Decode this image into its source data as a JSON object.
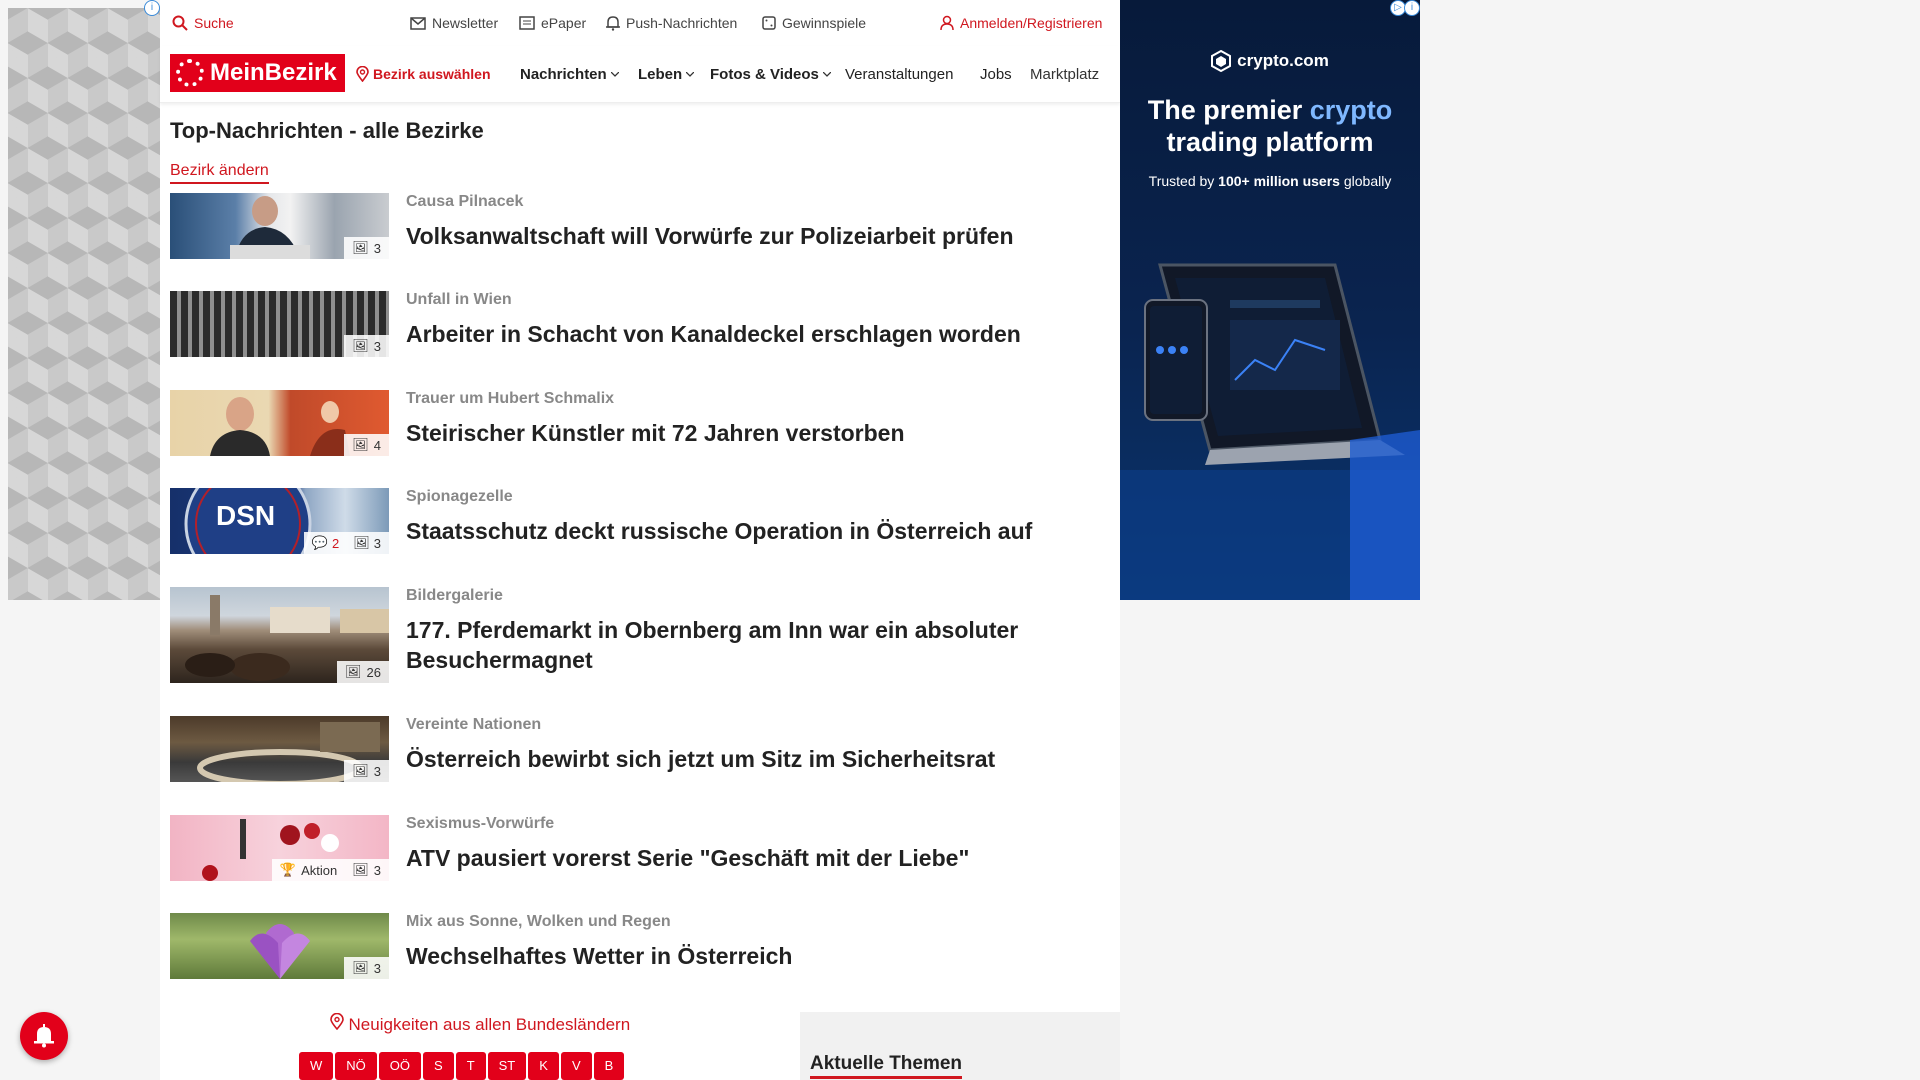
{
  "topbar": {
    "search": "Suche",
    "newsletter": "Newsletter",
    "epaper": "ePaper",
    "push": "Push-Nachrichten",
    "games": "Gewinnspiele",
    "login": "Anmelden/Registrieren"
  },
  "nav": {
    "logo": "MeinBezirk",
    "district": "Bezirk auswählen",
    "items": [
      "Nachrichten",
      "Leben",
      "Fotos & Videos",
      "Veranstaltungen",
      "Jobs",
      "Marktplatz"
    ]
  },
  "page": {
    "title": "Top-Nachrichten - alle Bezirke",
    "change_district": "Bezirk ändern"
  },
  "articles": [
    {
      "kicker": "Causa Pilnacek",
      "title": "Volksanwaltschaft will Vorwürfe zur Polizeiarbeit prüfen",
      "images": "3"
    },
    {
      "kicker": "Unfall in Wien",
      "title": "Arbeiter in Schacht von Kanaldeckel erschlagen worden",
      "images": "3"
    },
    {
      "kicker": "Trauer um Hubert Schmalix",
      "title": "Steirischer Künstler mit 72 Jahren verstorben",
      "images": "4"
    },
    {
      "kicker": "Spionagezelle",
      "title": "Staatsschutz deckt russische Operation in Österreich auf",
      "images": "3",
      "comments": "2",
      "thumb_text": "DSN"
    },
    {
      "kicker": "Bildergalerie",
      "title": "177. Pferdemarkt in Obernberg am Inn war ein absoluter Besuchermagnet",
      "images": "26"
    },
    {
      "kicker": "Vereinte Nationen",
      "title": "Österreich bewirbt sich jetzt um Sitz im Sicherheitsrat",
      "images": "3"
    },
    {
      "kicker": "Sexismus-Vorwürfe",
      "title": "ATV pausiert vorerst Serie \"Geschäft mit der Liebe\"",
      "images": "3",
      "tag": "Aktion"
    },
    {
      "kicker": "Mix aus Sonne, Wolken und Regen",
      "title": "Wechselhaftes Wetter in Österreich",
      "images": "3"
    }
  ],
  "footer": {
    "all_states": "Neuigkeiten aus allen Bundesländern",
    "states": [
      "W",
      "NÖ",
      "OÖ",
      "S",
      "T",
      "ST",
      "K",
      "V",
      "B"
    ],
    "themes": "Aktuelle Themen"
  },
  "ad": {
    "brand": "crypto.com",
    "headline_1": "The premier ",
    "headline_accent": "crypto",
    "headline_2": "trading platform",
    "tagline_1": "Trusted by ",
    "tagline_bold": "100+ million users",
    "tagline_2": " globally",
    "info": "i"
  },
  "colors": {
    "accent": "#e2001a",
    "kicker": "#888888",
    "ad_bg": "#0a2450"
  }
}
